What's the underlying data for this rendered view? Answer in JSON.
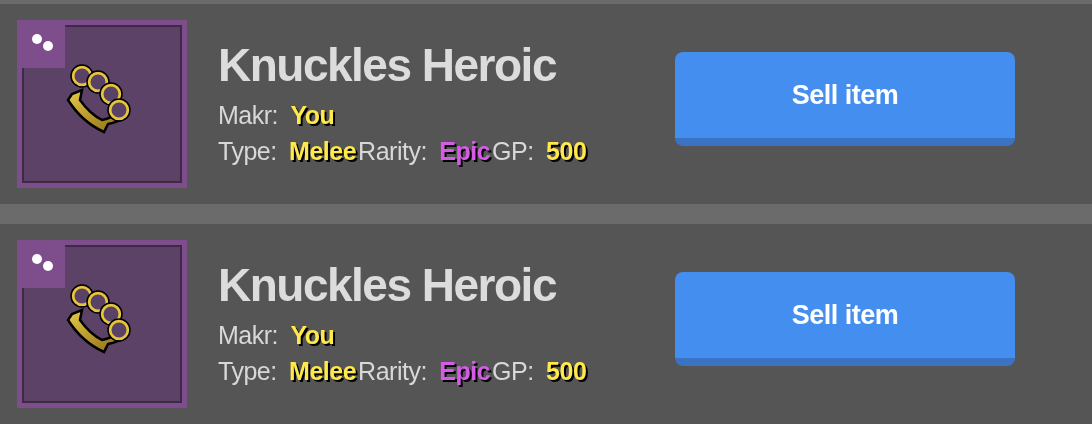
{
  "items": [
    {
      "name": "Knuckles Heroic",
      "maker_label": "Makr:",
      "maker": "You",
      "fields": [
        {
          "label": "Type:",
          "value": "Melee",
          "color": "#ffe94a"
        },
        {
          "label": "Rarity:",
          "value": "Epic",
          "color": "#d65ce8"
        },
        {
          "label": "GP:",
          "value": "500",
          "color": "#ffe94a"
        }
      ],
      "button": "Sell item"
    },
    {
      "name": "Knuckles Heroic",
      "maker_label": "Makr:",
      "maker": "You",
      "fields": [
        {
          "label": "Type:",
          "value": "Melee",
          "color": "#ffe94a"
        },
        {
          "label": "Rarity:",
          "value": "Epic",
          "color": "#d65ce8"
        },
        {
          "label": "GP:",
          "value": "500",
          "color": "#ffe94a"
        }
      ],
      "button": "Sell item"
    }
  ]
}
